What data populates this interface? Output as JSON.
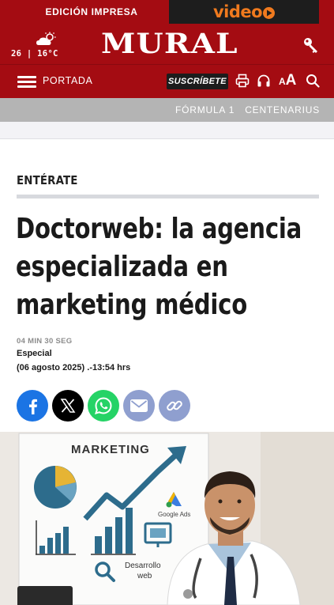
{
  "topbar": {
    "edition_label": "EDICIÓN IMPRESA",
    "video_label": "video"
  },
  "masthead": {
    "logo": "MURAL",
    "weather": {
      "icon": "cloud-sun-icon",
      "temperature": "26 | 16°C"
    }
  },
  "nav": {
    "section_label": "PORTADA",
    "subscribe_label": "SUSCRÍBETE",
    "font_size_small": "A",
    "font_size_big": "A"
  },
  "sections": {
    "links": [
      "FÓRMULA 1",
      "CENTENARIUS"
    ]
  },
  "article": {
    "kicker": "ENTÉRATE",
    "headline": "Doctorweb: la agencia especializada en marketing médico",
    "read_time": "04 MIN 30 SEG",
    "author": "Especial",
    "date": "(06 agosto 2025) .-13:54 hrs"
  },
  "share": {
    "buttons": [
      "facebook-icon",
      "x-icon",
      "whatsapp-icon",
      "mail-icon",
      "link-icon"
    ]
  },
  "hero": {
    "board_title": "MARKETING",
    "ads_label": "Google Ads",
    "dev_label_line1": "Desarrollo",
    "dev_label_line2": "web"
  },
  "colors": {
    "brand_red": "#a40c12",
    "video_orange": "#f07a1e",
    "section_gray": "#b4b4b4"
  }
}
